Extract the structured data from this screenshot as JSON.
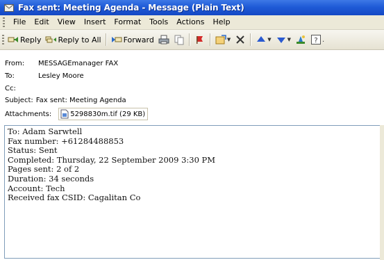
{
  "window": {
    "title": "Fax sent: Meeting Agenda - Message (Plain Text)"
  },
  "menu": {
    "items": [
      "File",
      "Edit",
      "View",
      "Insert",
      "Format",
      "Tools",
      "Actions",
      "Help"
    ]
  },
  "toolbar": {
    "reply_label": "Reply",
    "reply_all_label": "Reply to All",
    "forward_label": "Forward",
    "icons": [
      "reply-icon",
      "reply-all-icon",
      "forward-icon",
      "print-icon",
      "copy-icon",
      "flag-icon",
      "move-icon",
      "delete-icon",
      "previous-icon",
      "next-icon",
      "find-contact-icon",
      "help-icon"
    ]
  },
  "message": {
    "from_label": "From:",
    "from_value": "MESSAGEmanager FAX",
    "to_label": "To:",
    "to_value": "Lesley Moore",
    "cc_label": "Cc:",
    "cc_value": "",
    "subject_label": "Subject:",
    "subject_value": "Fax sent: Meeting Agenda",
    "attachments_label": "Attachments:",
    "attachment_name": "5298830m.tif (29 KB)"
  },
  "body": {
    "lines": [
      "To: Adam Sarwtell",
      "Fax number: +61284488853",
      "Status: Sent",
      "Completed: Thursday, 22 September 2009 3:30 PM",
      "Pages sent: 2 of 2",
      "Duration: 34 seconds",
      "Account: Tech",
      "Received fax CSID: Cagalitan Co"
    ]
  },
  "colors": {
    "titlebar": "#1f5bd7",
    "chrome": "#ece9d8",
    "body_border": "#7f9db9"
  }
}
